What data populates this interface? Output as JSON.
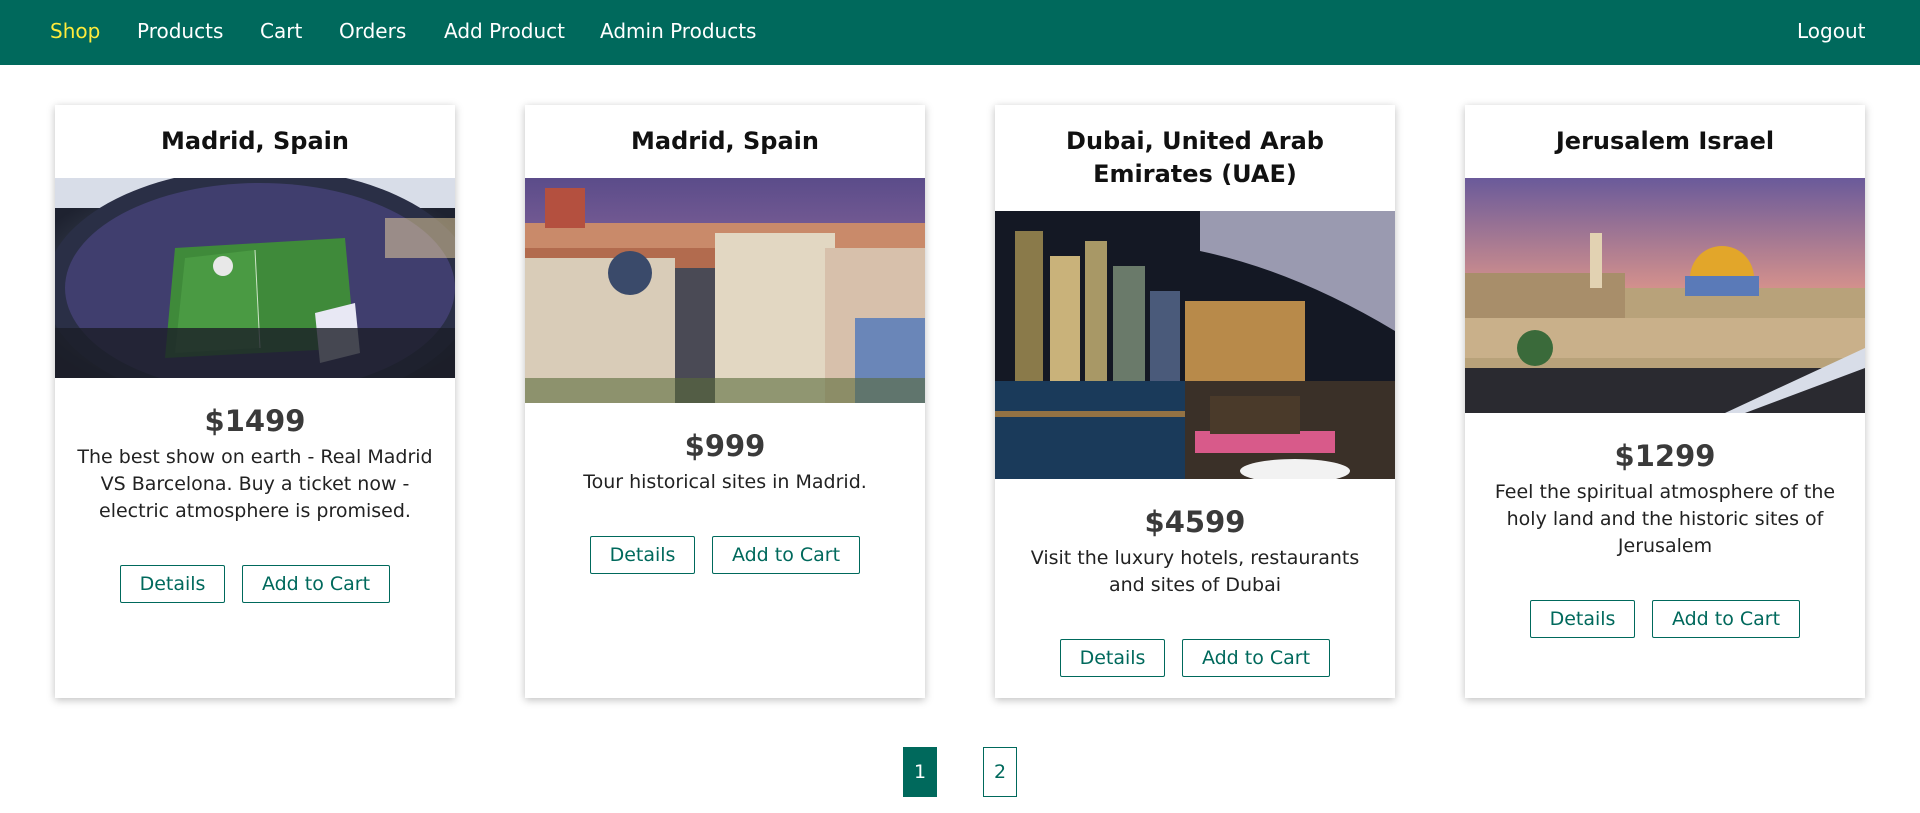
{
  "nav": {
    "items": [
      {
        "label": "Shop",
        "active": true
      },
      {
        "label": "Products"
      },
      {
        "label": "Cart"
      },
      {
        "label": "Orders"
      },
      {
        "label": "Add Product"
      },
      {
        "label": "Admin Products"
      }
    ],
    "logout_label": "Logout",
    "colors": {
      "bar": "#00695c",
      "active": "#ffeb3b",
      "text": "#ffffff"
    }
  },
  "products": [
    {
      "title": "Madrid, Spain",
      "price": "$1499",
      "description": "The best show on earth - Real Madrid VS Barcelona. Buy a ticket now - electric atmosphere is promised.",
      "details_label": "Details",
      "add_label": "Add to Cart"
    },
    {
      "title": "Madrid, Spain",
      "price": "$999",
      "description": "Tour historical sites in Madrid.",
      "details_label": "Details",
      "add_label": "Add to Cart"
    },
    {
      "title": "Dubai, United Arab Emirates (UAE)",
      "price": "$4599",
      "description": "Visit the luxury hotels, restaurants and sites of Dubai",
      "details_label": "Details",
      "add_label": "Add to Cart"
    },
    {
      "title": "Jerusalem Israel",
      "price": "$1299",
      "description": "Feel the spiritual atmosphere of the holy land and the historic sites of Jerusalem",
      "details_label": "Details",
      "add_label": "Add to Cart"
    }
  ],
  "pagination": {
    "pages": [
      "1",
      "2"
    ],
    "current": "1"
  }
}
